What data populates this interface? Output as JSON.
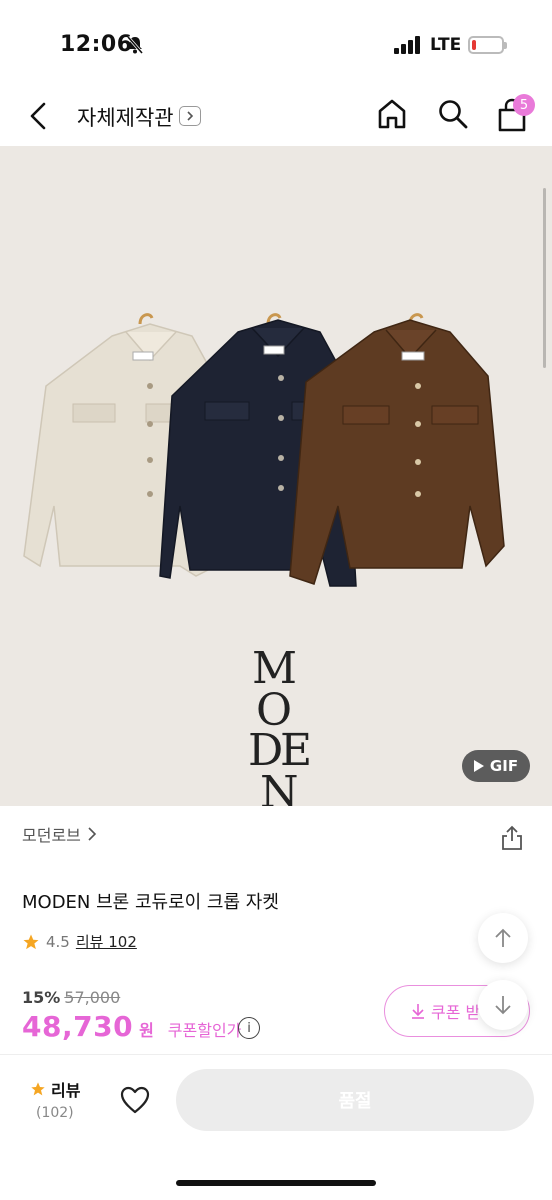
{
  "status_bar": {
    "time": "12:06",
    "network": "LTE"
  },
  "header": {
    "title": "자체제작관",
    "cart_count": "5"
  },
  "hero": {
    "logo_lines": [
      "M",
      "O",
      "D",
      "E",
      "N"
    ],
    "gif_label": "GIF"
  },
  "product": {
    "brand": "모던로브",
    "name": "MODEN 브론 코듀로이 크롭 자켓",
    "rating": "4.5",
    "review_label": "리뷰 102",
    "discount": "15%",
    "original_price": "57,000",
    "price": "48,730",
    "currency": "원",
    "coupon_price_label": "쿠폰할인가",
    "coupon_button": "쿠폰 받"
  },
  "bottom_bar": {
    "review_label": "리뷰",
    "review_count": "(102)",
    "soldout_label": "품절"
  },
  "colors": {
    "accent": "#e666d6",
    "star": "#f5a623",
    "jacket_cream": "#e6e0d3",
    "jacket_navy": "#1e2333",
    "jacket_brown": "#5e3b22"
  }
}
